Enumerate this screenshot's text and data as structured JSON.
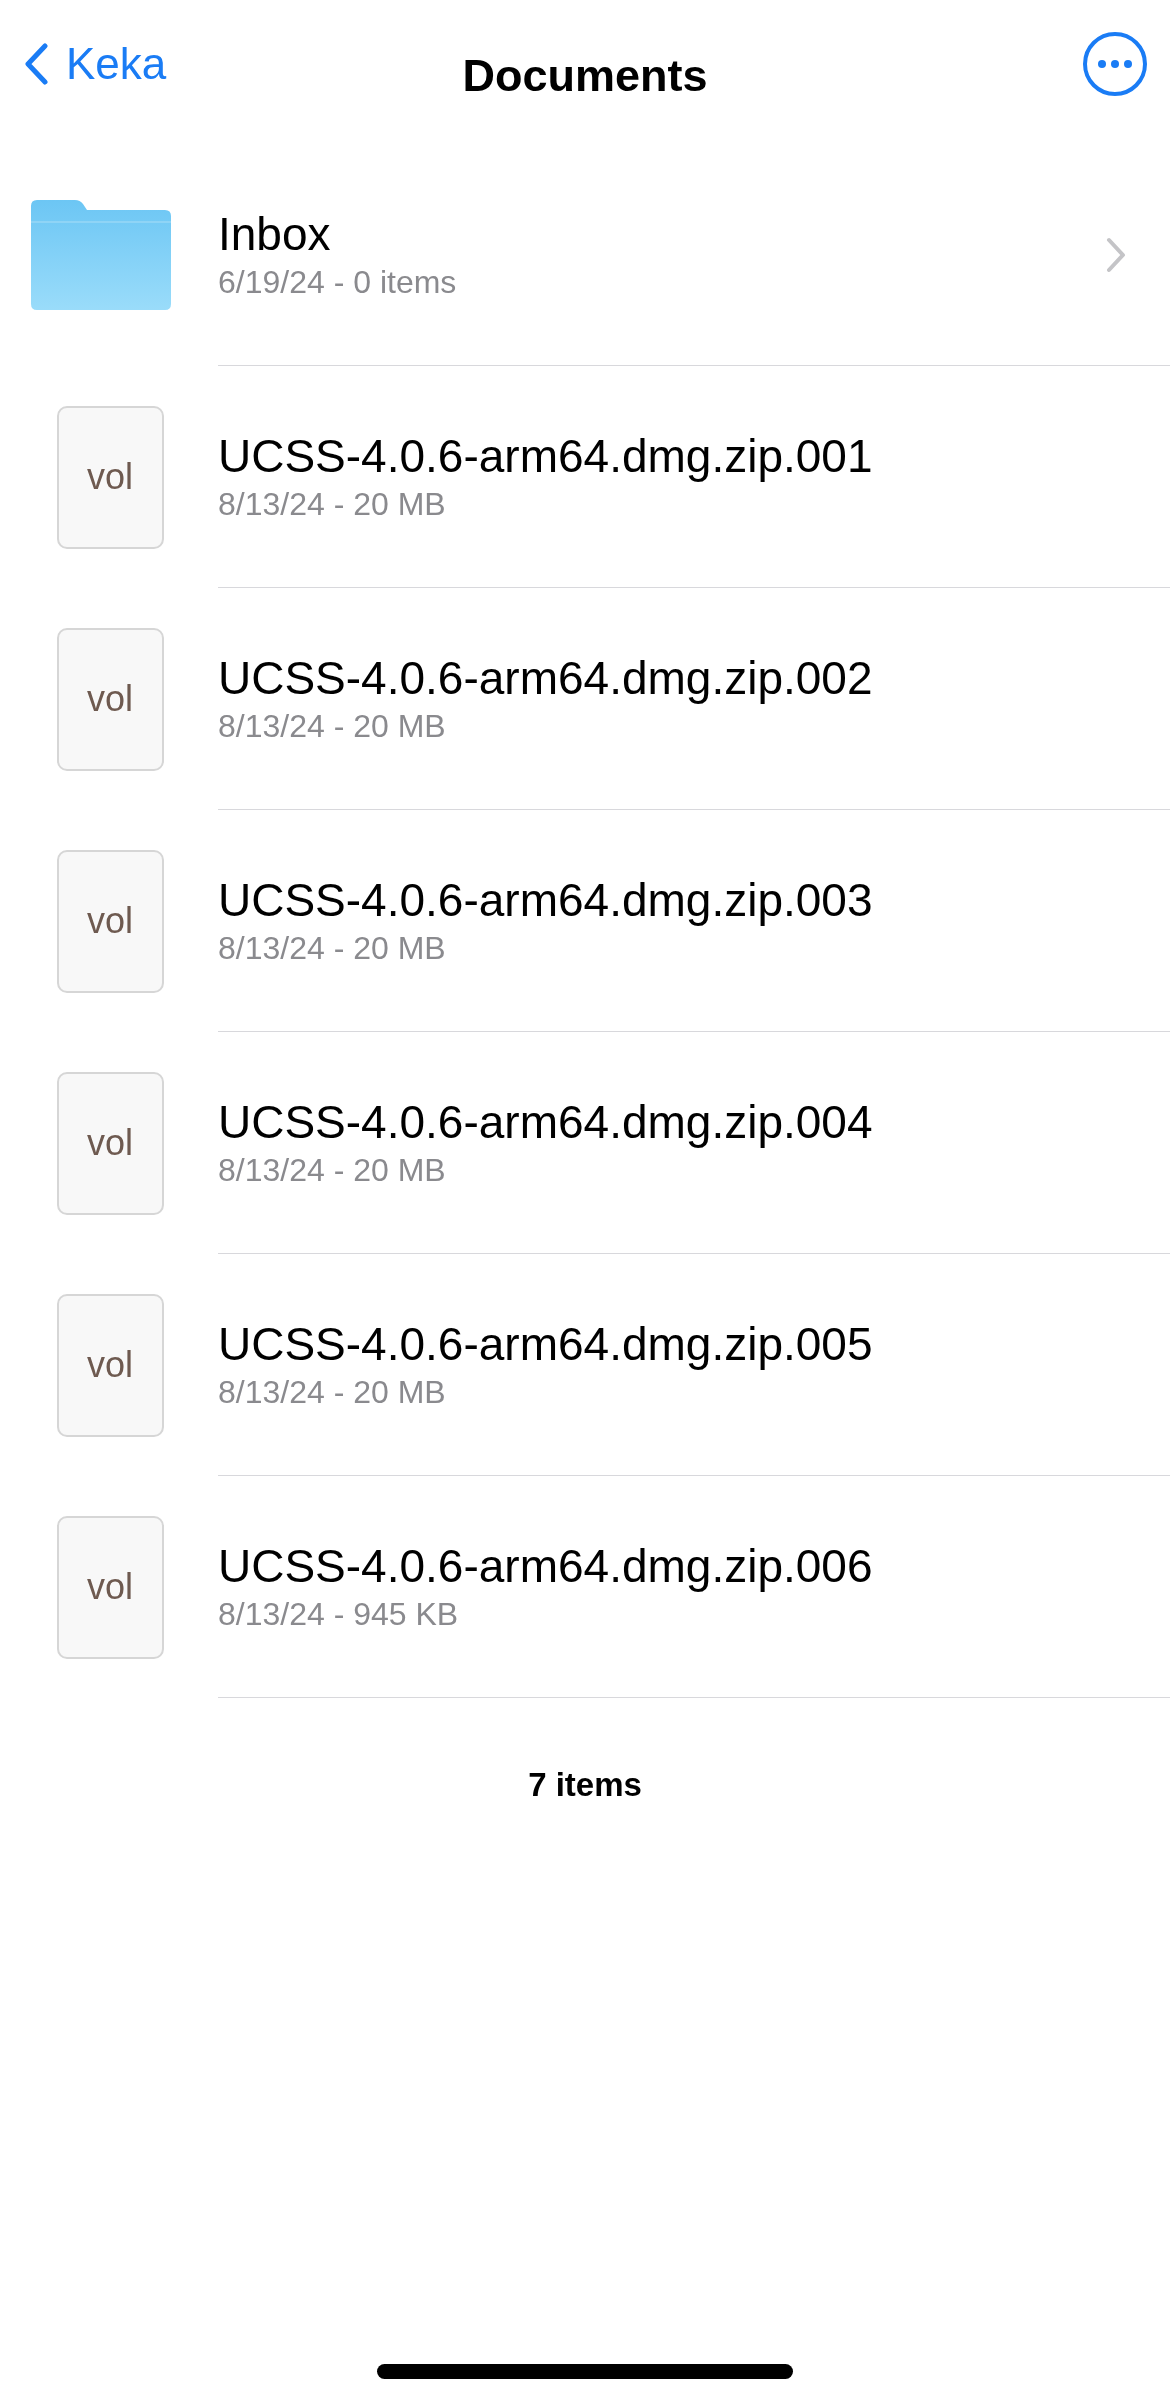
{
  "nav": {
    "back_label": "Keka",
    "title": "Documents"
  },
  "items": [
    {
      "kind": "folder",
      "name": "Inbox",
      "details": "6/19/24 - 0 items"
    },
    {
      "kind": "file",
      "icon_label": "vol",
      "name": "UCSS-4.0.6-arm64.dmg.zip.001",
      "details": "8/13/24 - 20 MB"
    },
    {
      "kind": "file",
      "icon_label": "vol",
      "name": "UCSS-4.0.6-arm64.dmg.zip.002",
      "details": "8/13/24 - 20 MB"
    },
    {
      "kind": "file",
      "icon_label": "vol",
      "name": "UCSS-4.0.6-arm64.dmg.zip.003",
      "details": "8/13/24 - 20 MB"
    },
    {
      "kind": "file",
      "icon_label": "vol",
      "name": "UCSS-4.0.6-arm64.dmg.zip.004",
      "details": "8/13/24 - 20 MB"
    },
    {
      "kind": "file",
      "icon_label": "vol",
      "name": "UCSS-4.0.6-arm64.dmg.zip.005",
      "details": "8/13/24 - 20 MB"
    },
    {
      "kind": "file",
      "icon_label": "vol",
      "name": "UCSS-4.0.6-arm64.dmg.zip.006",
      "details": "8/13/24 - 945 KB"
    }
  ],
  "footer": {
    "count": "7 items"
  }
}
